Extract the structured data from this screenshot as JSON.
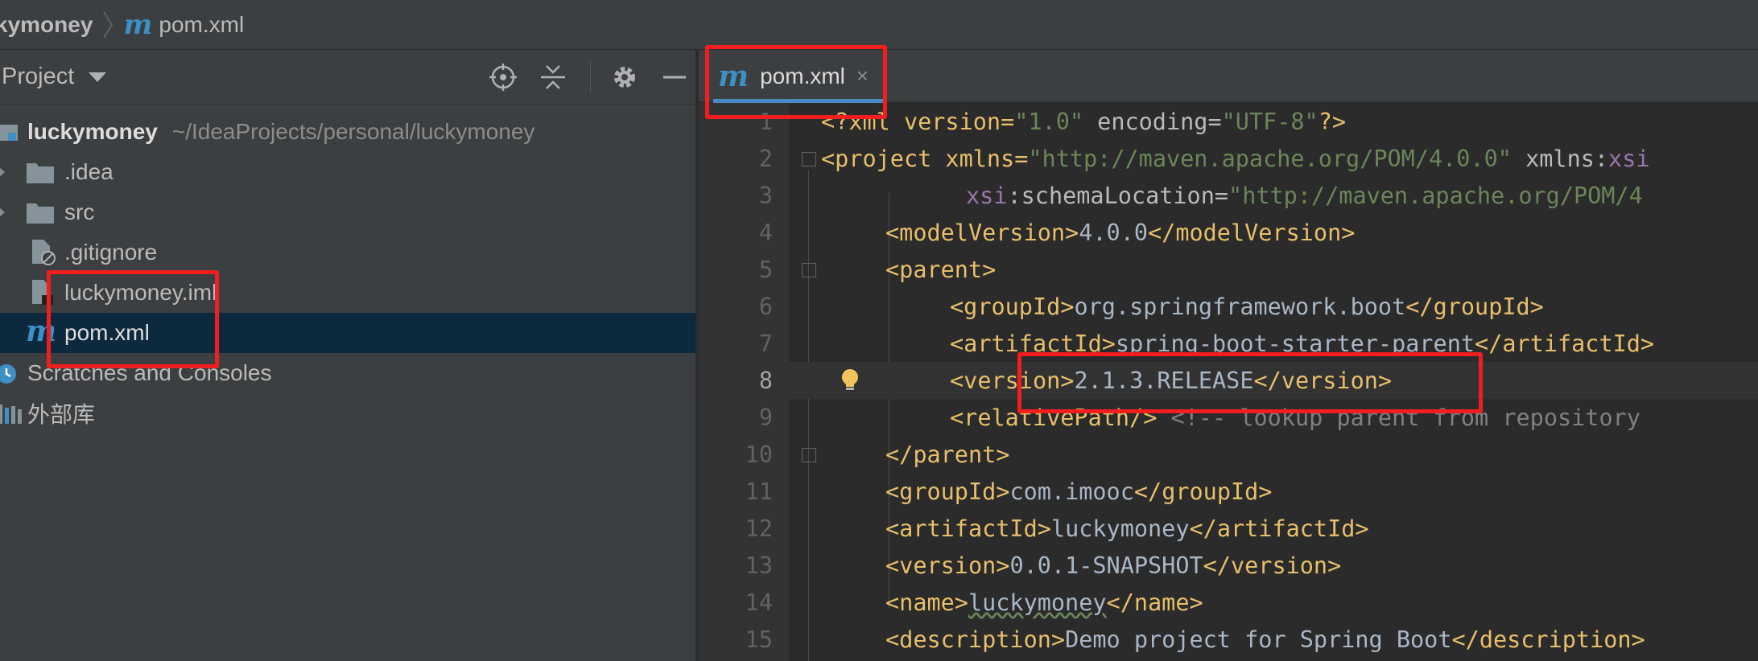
{
  "breadcrumb": {
    "project": "kymoney",
    "file": "pom.xml"
  },
  "project_pane": {
    "title": "Project",
    "tools": [
      "locate-icon",
      "collapse-all-icon",
      "gear-icon",
      "hide-icon"
    ],
    "tree": [
      {
        "label": "luckymoney",
        "hint": "~/IdeaProjects/personal/luckymoney",
        "icon": "module-folder-icon"
      },
      {
        "label": ".idea",
        "icon": "folder-icon"
      },
      {
        "label": "src",
        "icon": "folder-icon"
      },
      {
        "label": ".gitignore",
        "icon": "ignored-file-icon"
      },
      {
        "label": "luckymoney.iml",
        "icon": "iml-file-icon"
      },
      {
        "label": "pom.xml",
        "icon": "maven-icon",
        "selected": true
      },
      {
        "label": "Scratches and Consoles",
        "icon": "scratches-icon"
      },
      {
        "label": "外部库",
        "icon": "libraries-icon"
      }
    ]
  },
  "editor": {
    "tab_label": "pom.xml",
    "tab_close": "×",
    "caret_line": 8,
    "lines": [
      {
        "n": "1"
      },
      {
        "n": "2"
      },
      {
        "n": "3"
      },
      {
        "n": "4"
      },
      {
        "n": "5"
      },
      {
        "n": "6"
      },
      {
        "n": "7"
      },
      {
        "n": "8"
      },
      {
        "n": "9"
      },
      {
        "n": "10"
      },
      {
        "n": "11"
      },
      {
        "n": "12"
      },
      {
        "n": "13"
      },
      {
        "n": "14"
      },
      {
        "n": "15"
      }
    ],
    "code": {
      "l1_a": "<?xml version=",
      "l1_b": "\"1.0\"",
      "l1_c": " encoding=",
      "l1_d": "\"UTF-8\"",
      "l1_e": "?>",
      "l2_a": "<project xmlns=",
      "l2_b": "\"http://maven.apache.org/POM/4.0.0\"",
      "l2_c": " xmlns:",
      "l2_d": "xsi",
      "l3_a": "xsi",
      "l3_b": ":schemaLocation=",
      "l3_c": "\"http://maven.apache.org/POM/4",
      "l4_a": "<modelVersion>",
      "l4_b": "4.0.0",
      "l4_c": "</modelVersion>",
      "l5_a": "<parent>",
      "l6_a": "<groupId>",
      "l6_b": "org.springframework.boot",
      "l6_c": "</groupId>",
      "l7_a": "<artifactId>",
      "l7_b": "spring-boot-starter-parent",
      "l7_c": "</artifactId>",
      "l8_a": "<version>",
      "l8_b": "2.1.3.RELEASE",
      "l8_c": "</version>",
      "l9_a": "<relativePath/>",
      "l9_b": " <!-- lookup parent from repository",
      "l10_a": "</parent>",
      "l11_a": "<groupId>",
      "l11_b": "com.imooc",
      "l11_c": "</groupId>",
      "l12_a": "<artifactId>",
      "l12_b": "luckymoney",
      "l12_c": "</artifactId>",
      "l13_a": "<version>",
      "l13_b": "0.0.1-SNAPSHOT",
      "l13_c": "</version>",
      "l14_a": "<name>",
      "l14_b": "luckymoney",
      "l14_c": "</name>",
      "l15_a": "<description>",
      "l15_b": "Demo project for Spring Boot",
      "l15_c": "</description>"
    }
  },
  "colors": {
    "highlight": "#f01e1e",
    "selection": "#0d293e",
    "maven_icon": "#3d8fc4",
    "tag": "#e8bf6a",
    "string": "#6a8759"
  }
}
